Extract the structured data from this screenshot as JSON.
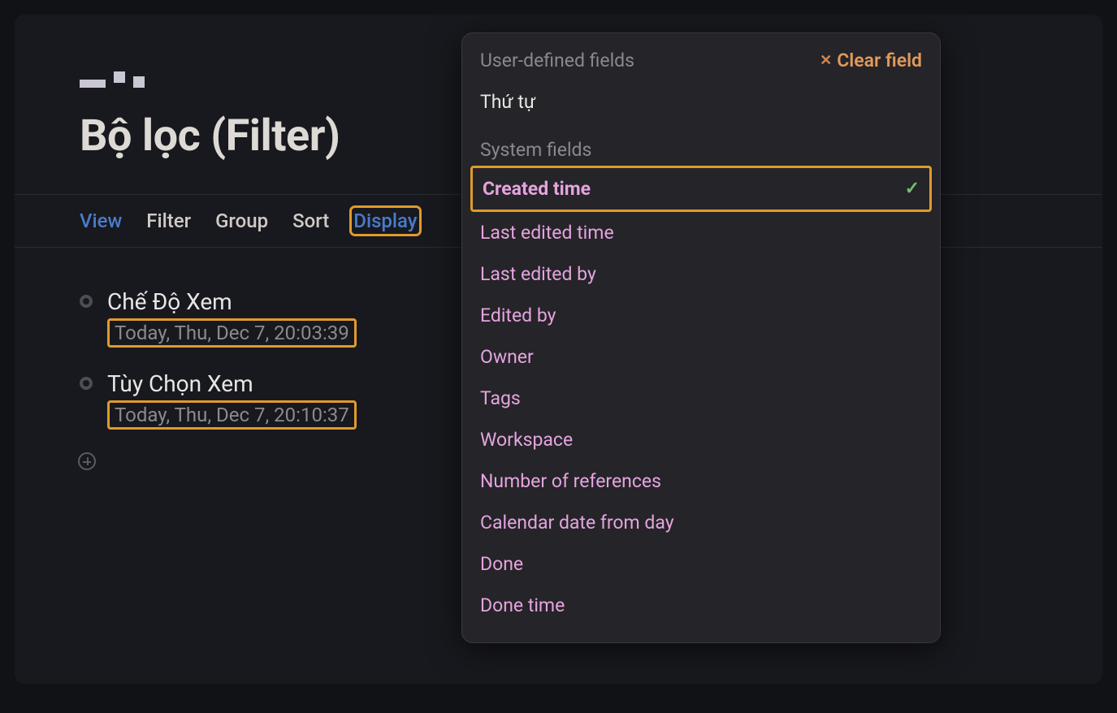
{
  "page": {
    "title": "Bộ lọc (Filter)"
  },
  "tabs": {
    "view": "View",
    "filter": "Filter",
    "group": "Group",
    "sort": "Sort",
    "display": "Display"
  },
  "list": {
    "items": [
      {
        "title": "Chế Độ Xem",
        "subtitle": "Today, Thu, Dec 7, 20:03:39"
      },
      {
        "title": "Tùy Chọn Xem",
        "subtitle": "Today, Thu, Dec 7, 20:10:37"
      }
    ]
  },
  "popup": {
    "user_defined_label": "User-defined fields",
    "clear_label": "Clear field",
    "user_items": [
      "Thứ tự"
    ],
    "system_label": "System fields",
    "system_items": [
      "Created time",
      "Last edited time",
      "Last edited by",
      "Edited by",
      "Owner",
      "Tags",
      "Workspace",
      "Number of references",
      "Calendar date from day",
      "Done",
      "Done time"
    ],
    "selected": "Created time"
  }
}
